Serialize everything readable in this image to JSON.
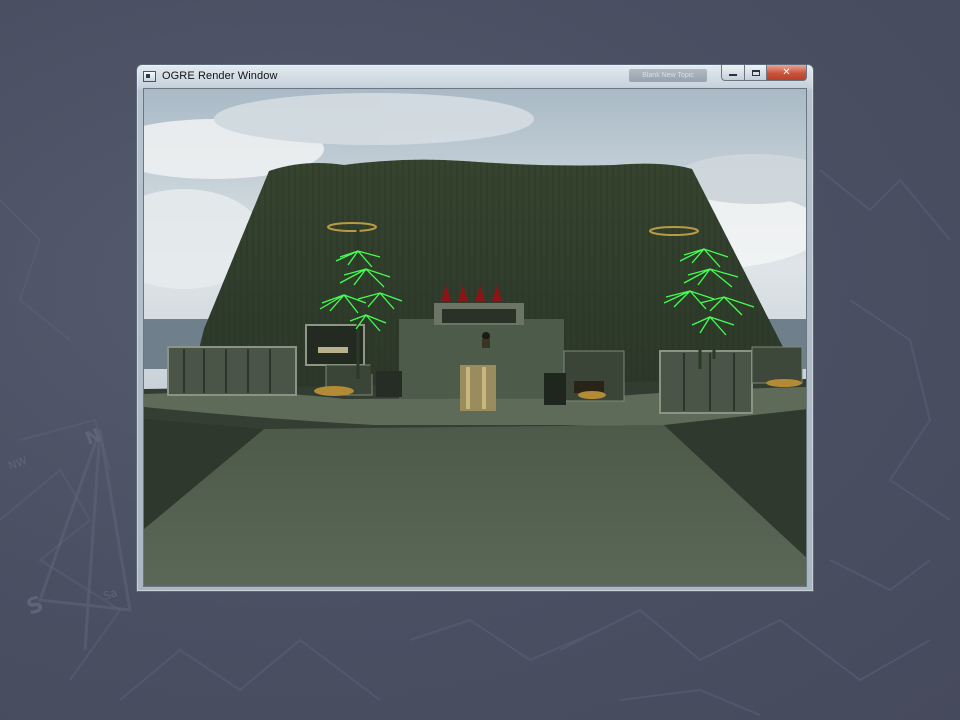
{
  "window": {
    "title": "OGRE Render Window",
    "taskbar_ghost_text": "Blank New Topic",
    "icon": "application-window-icon",
    "buttons": {
      "minimize_icon": "minimize-icon",
      "maximize_icon": "maximize-icon",
      "close_label": "✕"
    }
  },
  "scene": {
    "description_type": "3d-render-viewport",
    "sky_colors": [
      "#b9c8d2",
      "#dfe6ea",
      "#8e9ea8"
    ],
    "ground_color": "#3f4a3e",
    "path_color": "#6a7566",
    "mountain_color": "#2d3a2c",
    "plant_color": "#43ff52",
    "spike_color": "#8b1418",
    "gate_stripe_color": "#b4a06a"
  },
  "slide": {
    "background_color": "#4b5063"
  }
}
